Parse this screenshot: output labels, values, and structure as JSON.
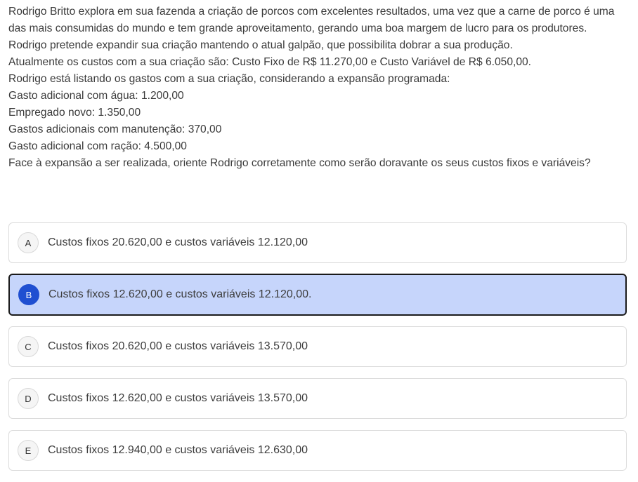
{
  "question": {
    "lines": [
      "Rodrigo Britto explora em sua fazenda a criação de porcos com excelentes resultados, uma vez que a carne de porco é uma das mais consumidas do mundo e tem grande aproveitamento, gerando uma boa margem de lucro para os produtores.",
      "Rodrigo pretende expandir sua criação mantendo o atual galpão, que possibilita dobrar a sua produção.",
      "Atualmente os custos com a sua criação são: Custo Fixo de R$ 11.270,00 e Custo Variável de R$ 6.050,00.",
      "Rodrigo está listando os gastos com a sua criação, considerando a expansão programada:",
      "Gasto adicional com água: 1.200,00",
      "Empregado novo: 1.350,00",
      "Gastos adicionais com manutenção: 370,00",
      "Gasto adicional com ração: 4.500,00",
      "Face à expansão a ser realizada, oriente Rodrigo corretamente como serão doravante os seus custos fixos e variáveis?"
    ]
  },
  "options": [
    {
      "letter": "A",
      "text": "Custos fixos 20.620,00 e custos variáveis 12.120,00",
      "selected": false
    },
    {
      "letter": "B",
      "text": "Custos fixos 12.620,00 e custos variáveis 12.120,00.",
      "selected": true
    },
    {
      "letter": "C",
      "text": "Custos fixos 20.620,00 e custos variáveis 13.570,00",
      "selected": false
    },
    {
      "letter": "D",
      "text": "Custos fixos 12.620,00 e custos variáveis 13.570,00",
      "selected": false
    },
    {
      "letter": "E",
      "text": "Custos fixos 12.940,00 e custos variáveis 12.630,00",
      "selected": false
    }
  ],
  "colors": {
    "selected_background": "#c6d5fb",
    "selected_badge": "#1f4fd1",
    "selected_border": "#1a1a1a"
  }
}
